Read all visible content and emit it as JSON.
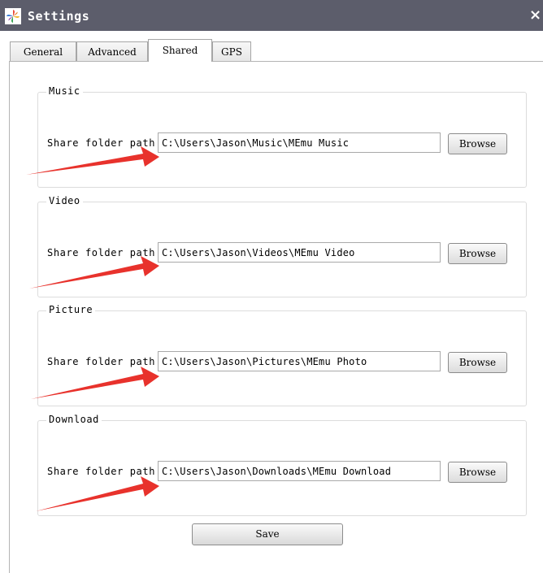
{
  "window": {
    "title": "Settings",
    "close_glyph": "×"
  },
  "tabs": [
    {
      "label": "General"
    },
    {
      "label": "Advanced"
    },
    {
      "label": "Shared",
      "active": true
    },
    {
      "label": "GPS"
    }
  ],
  "groups": [
    {
      "title": "Music",
      "field_label": "Share folder path",
      "path": "C:\\Users\\Jason\\Music\\MEmu Music",
      "browse_label": "Browse"
    },
    {
      "title": "Video",
      "field_label": "Share folder path",
      "path": "C:\\Users\\Jason\\Videos\\MEmu Video",
      "browse_label": "Browse"
    },
    {
      "title": "Picture",
      "field_label": "Share folder path",
      "path": "C:\\Users\\Jason\\Pictures\\MEmu Photo",
      "browse_label": "Browse"
    },
    {
      "title": "Download",
      "field_label": "Share folder path",
      "path": "C:\\Users\\Jason\\Downloads\\MEmu Download",
      "browse_label": "Browse"
    }
  ],
  "footer": {
    "save_label": "Save"
  },
  "colors": {
    "titlebar": "#5c5d6b",
    "annotation_arrow": "#e8322c"
  },
  "icons": {
    "app": "memu-pinwheel-icon",
    "close": "close-icon",
    "annotation": "red-arrow-annotation"
  }
}
